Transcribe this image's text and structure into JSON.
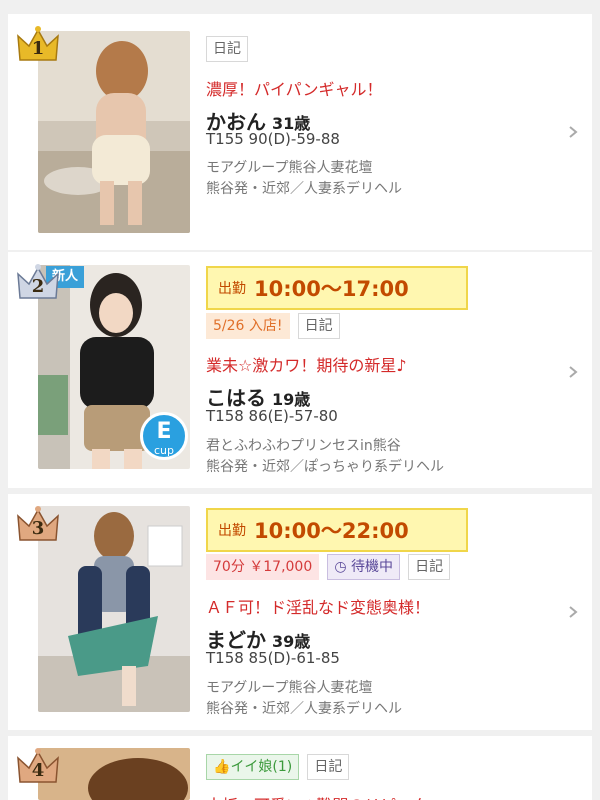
{
  "listings": [
    {
      "rank": "1",
      "tags": [
        "日記"
      ],
      "catch": "濃厚！パイパンギャル！",
      "name": "かおん",
      "age": "31歳",
      "size": "T155 90(D)-59-88",
      "shop": "モアグループ熊谷人妻花壇",
      "area": "熊谷発・近郊／人妻系デリヘル"
    },
    {
      "rank": "2",
      "badge_new": "新人",
      "shift_label": "出勤",
      "shift_time": "10:00～17:00",
      "tag_nyuten": "5/26 入店!",
      "tags": [
        "日記"
      ],
      "catch": "業未☆激カワ！期待の新星♪",
      "name": "こはる",
      "age": "19歳",
      "size": "T158 86(E)-57-80",
      "shop": "君とふわふわプリンセスin熊谷",
      "area": "熊谷発・近郊／ぽっちゃり系デリヘル",
      "cup_badge": "E",
      "cup_label": "cup"
    },
    {
      "rank": "3",
      "shift_label": "出勤",
      "shift_time": "10:00～22:00",
      "tag_price": "70分 ￥17,000",
      "tag_taiki": "待機中",
      "tags": [
        "日記"
      ],
      "catch": "ＡＦ可！ド淫乱なド変態奥様！",
      "name": "まどか",
      "age": "39歳",
      "size": "T158 85(D)-61-85",
      "shop": "モアグループ熊谷人妻花壇",
      "area": "熊谷発・近郊／人妻系デリヘル"
    },
    {
      "rank": "4",
      "tag_ii": "イイ娘(1)",
      "tags": [
        "日記"
      ],
      "catch": "古板・可愛い★難関のリピーター"
    }
  ],
  "colors": {
    "gold": "#e8b928",
    "silver": "#a9b4c8",
    "bronze": "#c98a5c",
    "accent_red": "#d42a2a",
    "shift_bg": "#fff7b0"
  }
}
